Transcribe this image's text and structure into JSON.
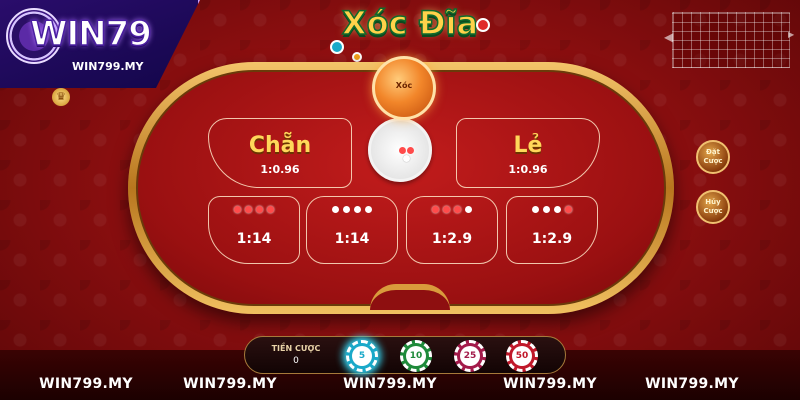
{
  "logo": {
    "text": "WIN79",
    "url": "WIN799.MY"
  },
  "game_title": "Xóc Đĩa",
  "bowl_label": "Xóc",
  "zones": {
    "even": {
      "label": "Chẵn",
      "odds": "1:0.96"
    },
    "odd": {
      "label": "Lẻ",
      "odds": "1:0.96"
    },
    "combos": [
      {
        "dots": [
          "red",
          "red",
          "red",
          "red"
        ],
        "odds": "1:14"
      },
      {
        "dots": [
          "white",
          "white",
          "white",
          "white"
        ],
        "odds": "1:14"
      },
      {
        "dots": [
          "red",
          "red",
          "red",
          "white"
        ],
        "odds": "1:2.9"
      },
      {
        "dots": [
          "white",
          "white",
          "white",
          "red"
        ],
        "odds": "1:2.9"
      }
    ]
  },
  "side_buttons": [
    {
      "label": "Đặt Cược"
    },
    {
      "label": "Hủy Cược"
    }
  ],
  "bet": {
    "label": "TIỀN CƯỢC",
    "value": "0"
  },
  "chips": [
    {
      "value": "5",
      "color": "#1aa9c9",
      "active": true
    },
    {
      "value": "10",
      "color": "#1e8a3a",
      "active": false
    },
    {
      "value": "25",
      "color": "#a21a4a",
      "active": false
    },
    {
      "value": "50",
      "color": "#c0182a",
      "active": false
    }
  ],
  "watermarks": [
    "WIN799.MY",
    "WIN799.MY",
    "WIN799.MY",
    "WIN799.MY",
    "WIN799.MY"
  ],
  "colors": {
    "table_felt": "#9a1011",
    "table_rim": "#d99b3c",
    "title": "#ffd24a",
    "logo_bg": "#2a0d6b"
  }
}
